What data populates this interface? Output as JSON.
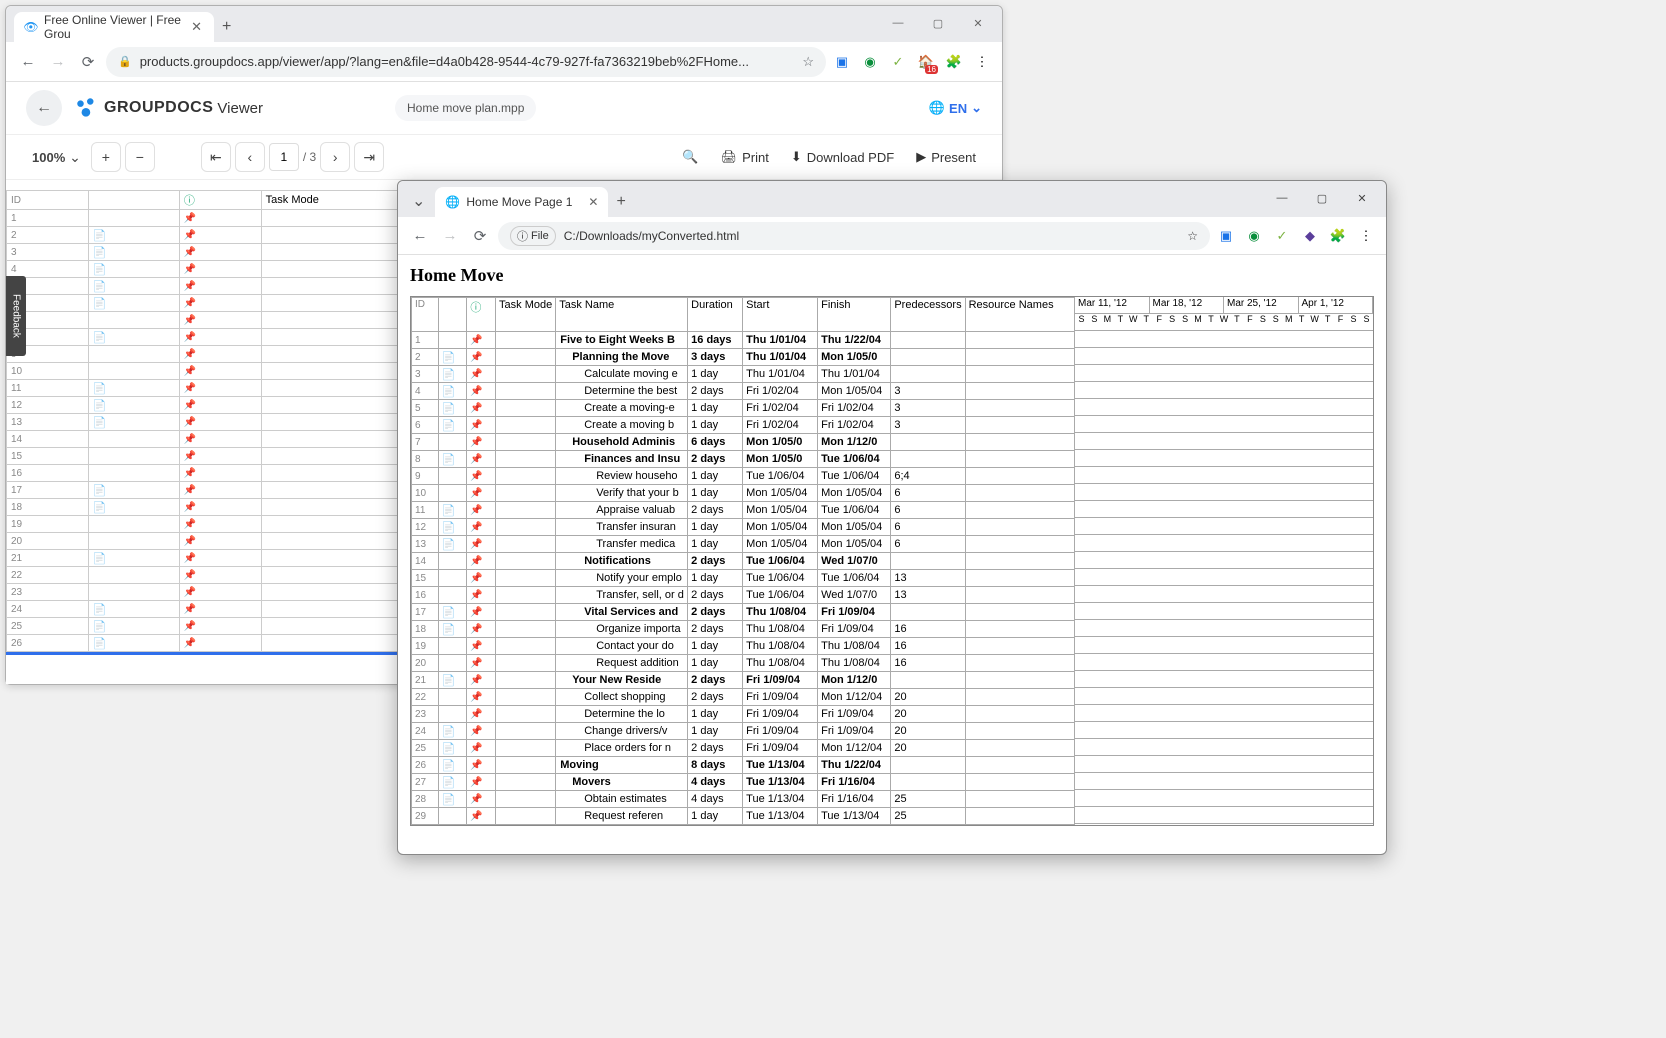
{
  "back": {
    "tab_title": "Free Online Viewer | Free Grou",
    "url": "products.groupdocs.app/viewer/app/?lang=en&file=d4a0b428-9544-4c79-927f-fa7363219beb%2FHome...",
    "ext_badge": "16",
    "gd_brand": "GROUPDOCS",
    "gd_brand2": "Viewer",
    "gd_file": "Home move plan.mpp",
    "lang": "EN",
    "zoom": "100%",
    "page_cur": "1",
    "page_tot": "/ 3",
    "act_print": "Print",
    "act_pdf": "Download PDF",
    "act_present": "Present",
    "feedback": "Feedback",
    "headers": [
      "ID",
      "",
      "",
      "Task Mode",
      "Task Name",
      "Duration",
      "Start"
    ],
    "rows": [
      {
        "id": "1",
        "note": "",
        "name": "Five to Eight Weeks Before",
        "dur": "16 days",
        "start": "Thu 1",
        "bold": true,
        "ind": 0
      },
      {
        "id": "2",
        "note": "y",
        "name": "Planning the Move",
        "dur": "3 days",
        "start": "Thu 1",
        "bold": true,
        "ind": 1
      },
      {
        "id": "3",
        "note": "y",
        "name": "Calculate moving exp",
        "dur": "1 day",
        "start": "Thu 1",
        "ind": 2
      },
      {
        "id": "4",
        "note": "y",
        "name": "Determine the best n",
        "dur": "2 days",
        "start": "Fri 1/",
        "ind": 2
      },
      {
        "id": "5",
        "note": "y",
        "name": "Create a moving-exp",
        "dur": "1 day",
        "start": "Fri 1/",
        "ind": 2
      },
      {
        "id": "6",
        "note": "y",
        "name": "Create a moving bin",
        "dur": "1 day",
        "start": "Fri 1/",
        "ind": 2
      },
      {
        "id": "7",
        "note": "",
        "name": "Household Administration",
        "dur": "6 days",
        "start": "Mon",
        "bold": true,
        "ind": 1
      },
      {
        "id": "8",
        "note": "y",
        "name": "Finances and Insurance",
        "dur": "2 days",
        "start": "Mon",
        "bold": true,
        "ind": 2
      },
      {
        "id": "9",
        "note": "",
        "name": "Review household fi",
        "dur": "1 day",
        "start": "Tue 1",
        "ind": 3
      },
      {
        "id": "10",
        "note": "",
        "name": "Verify that your bel",
        "dur": "1 day",
        "start": "Mon",
        "ind": 3
      },
      {
        "id": "11",
        "note": "y",
        "name": "Appraise valuables",
        "dur": "2 days",
        "start": "Mon",
        "ind": 3
      },
      {
        "id": "12",
        "note": "y",
        "name": "Transfer insurance",
        "dur": "1 day",
        "start": "Mon",
        "ind": 3
      },
      {
        "id": "13",
        "note": "y",
        "name": "Transfer medical in",
        "dur": "1 day",
        "start": "Mon",
        "ind": 3
      },
      {
        "id": "14",
        "note": "",
        "name": "Notifications",
        "dur": "2 days",
        "start": "Tue 1",
        "bold": true,
        "ind": 2
      },
      {
        "id": "15",
        "note": "",
        "name": "Notify your employ",
        "dur": "1 day",
        "start": "Tue 1",
        "ind": 3
      },
      {
        "id": "16",
        "note": "",
        "name": "Transfer, sell, or di",
        "dur": "2 days",
        "start": "Tue 1",
        "ind": 3
      },
      {
        "id": "17",
        "note": "y",
        "name": "Vital Services and R",
        "dur": "2 days",
        "start": "Thu 1",
        "bold": true,
        "ind": 2
      },
      {
        "id": "18",
        "note": "y",
        "name": "Organize important",
        "dur": "2 days",
        "start": "Thu 1",
        "ind": 3
      },
      {
        "id": "19",
        "note": "",
        "name": "Contact your docto",
        "dur": "1 day",
        "start": "Thu 1",
        "ind": 3
      },
      {
        "id": "20",
        "note": "",
        "name": "Request additional",
        "dur": "1 day",
        "start": "Thu 1",
        "ind": 3
      },
      {
        "id": "21",
        "note": "y",
        "name": "Your New Residence",
        "dur": "2 days",
        "start": "Fri 1/",
        "bold": true,
        "ind": 1
      },
      {
        "id": "22",
        "note": "",
        "name": "Collect shopping a",
        "dur": "2 days",
        "start": "Fri 1/",
        "ind": 2
      },
      {
        "id": "23",
        "note": "",
        "name": "Determine the loca",
        "dur": "1 day",
        "start": "Fri 1/",
        "ind": 2
      },
      {
        "id": "24",
        "note": "y",
        "name": "Change drivers/veh",
        "dur": "1 day",
        "start": "Fri 1/",
        "ind": 2
      },
      {
        "id": "25",
        "note": "y",
        "name": "Place orders for ne",
        "dur": "2 days",
        "start": "Fri 1/",
        "ind": 2
      },
      {
        "id": "26",
        "note": "y",
        "name": "Moving",
        "dur": "8 days",
        "start": "Tue 1",
        "bold": true,
        "ind": 0
      }
    ]
  },
  "front": {
    "tab_title": "Home Move Page 1",
    "file_proto": "File",
    "url": "C:/Downloads/myConverted.html",
    "h1": "Home Move",
    "headers": [
      "ID",
      "",
      "",
      "Task Mode",
      "Task Name",
      "Duration",
      "Start",
      "Finish",
      "Predecessors",
      "Resource Names"
    ],
    "dates": [
      "Mar 11, '12",
      "Mar 18, '12",
      "Mar 25, '12",
      "Apr 1, '12"
    ],
    "days": "SSMTWTFSSMTWTFSSMTWTFSS",
    "rows": [
      {
        "id": "1",
        "note": "",
        "name": "Five to Eight Weeks B",
        "dur": "16 days",
        "start": "Thu 1/01/04",
        "fin": "Thu 1/22/04",
        "pred": "",
        "bold": true,
        "ind": 0
      },
      {
        "id": "2",
        "note": "y",
        "name": "Planning the Move",
        "dur": "3 days",
        "start": "Thu 1/01/04",
        "fin": "Mon 1/05/0",
        "pred": "",
        "bold": true,
        "ind": 1
      },
      {
        "id": "3",
        "note": "y",
        "name": "Calculate moving e",
        "dur": "1 day",
        "start": "Thu 1/01/04",
        "fin": "Thu 1/01/04",
        "pred": "",
        "ind": 2
      },
      {
        "id": "4",
        "note": "y",
        "name": "Determine the best",
        "dur": "2 days",
        "start": "Fri 1/02/04",
        "fin": "Mon 1/05/04",
        "pred": "3",
        "ind": 2
      },
      {
        "id": "5",
        "note": "y",
        "name": "Create a moving-e",
        "dur": "1 day",
        "start": "Fri 1/02/04",
        "fin": "Fri 1/02/04",
        "pred": "3",
        "ind": 2
      },
      {
        "id": "6",
        "note": "y",
        "name": "Create a moving b",
        "dur": "1 day",
        "start": "Fri 1/02/04",
        "fin": "Fri 1/02/04",
        "pred": "3",
        "ind": 2
      },
      {
        "id": "7",
        "note": "",
        "name": "Household Adminis",
        "dur": "6 days",
        "start": "Mon 1/05/0",
        "fin": "Mon 1/12/0",
        "pred": "",
        "bold": true,
        "ind": 1
      },
      {
        "id": "8",
        "note": "y",
        "name": "Finances and Insu",
        "dur": "2 days",
        "start": "Mon 1/05/0",
        "fin": "Tue 1/06/04",
        "pred": "",
        "bold": true,
        "ind": 2
      },
      {
        "id": "9",
        "note": "",
        "name": "Review househo",
        "dur": "1 day",
        "start": "Tue 1/06/04",
        "fin": "Tue 1/06/04",
        "pred": "6;4",
        "ind": 3
      },
      {
        "id": "10",
        "note": "",
        "name": "Verify that your b",
        "dur": "1 day",
        "start": "Mon 1/05/04",
        "fin": "Mon 1/05/04",
        "pred": "6",
        "ind": 3
      },
      {
        "id": "11",
        "note": "y",
        "name": "Appraise valuab",
        "dur": "2 days",
        "start": "Mon 1/05/04",
        "fin": "Tue 1/06/04",
        "pred": "6",
        "ind": 3
      },
      {
        "id": "12",
        "note": "y",
        "name": "Transfer insuran",
        "dur": "1 day",
        "start": "Mon 1/05/04",
        "fin": "Mon 1/05/04",
        "pred": "6",
        "ind": 3
      },
      {
        "id": "13",
        "note": "y",
        "name": "Transfer medica",
        "dur": "1 day",
        "start": "Mon 1/05/04",
        "fin": "Mon 1/05/04",
        "pred": "6",
        "ind": 3
      },
      {
        "id": "14",
        "note": "",
        "name": "Notifications",
        "dur": "2 days",
        "start": "Tue 1/06/04",
        "fin": "Wed 1/07/0",
        "pred": "",
        "bold": true,
        "ind": 2
      },
      {
        "id": "15",
        "note": "",
        "name": "Notify your emplo",
        "dur": "1 day",
        "start": "Tue 1/06/04",
        "fin": "Tue 1/06/04",
        "pred": "13",
        "ind": 3
      },
      {
        "id": "16",
        "note": "",
        "name": "Transfer, sell, or d",
        "dur": "2 days",
        "start": "Tue 1/06/04",
        "fin": "Wed 1/07/0",
        "pred": "13",
        "ind": 3
      },
      {
        "id": "17",
        "note": "y",
        "name": "Vital Services and",
        "dur": "2 days",
        "start": "Thu 1/08/04",
        "fin": "Fri 1/09/04",
        "pred": "",
        "bold": true,
        "ind": 2
      },
      {
        "id": "18",
        "note": "y",
        "name": "Organize importa",
        "dur": "2 days",
        "start": "Thu 1/08/04",
        "fin": "Fri 1/09/04",
        "pred": "16",
        "ind": 3
      },
      {
        "id": "19",
        "note": "",
        "name": "Contact your do",
        "dur": "1 day",
        "start": "Thu 1/08/04",
        "fin": "Thu 1/08/04",
        "pred": "16",
        "ind": 3
      },
      {
        "id": "20",
        "note": "",
        "name": "Request addition",
        "dur": "1 day",
        "start": "Thu 1/08/04",
        "fin": "Thu 1/08/04",
        "pred": "16",
        "ind": 3
      },
      {
        "id": "21",
        "note": "y",
        "name": "Your New Reside",
        "dur": "2 days",
        "start": "Fri 1/09/04",
        "fin": "Mon 1/12/0",
        "pred": "",
        "bold": true,
        "ind": 1
      },
      {
        "id": "22",
        "note": "",
        "name": "Collect shopping",
        "dur": "2 days",
        "start": "Fri 1/09/04",
        "fin": "Mon 1/12/04",
        "pred": "20",
        "ind": 2
      },
      {
        "id": "23",
        "note": "",
        "name": "Determine the lo",
        "dur": "1 day",
        "start": "Fri 1/09/04",
        "fin": "Fri 1/09/04",
        "pred": "20",
        "ind": 2
      },
      {
        "id": "24",
        "note": "y",
        "name": "Change drivers/v",
        "dur": "1 day",
        "start": "Fri 1/09/04",
        "fin": "Fri 1/09/04",
        "pred": "20",
        "ind": 2
      },
      {
        "id": "25",
        "note": "y",
        "name": "Place orders for n",
        "dur": "2 days",
        "start": "Fri 1/09/04",
        "fin": "Mon 1/12/04",
        "pred": "20",
        "ind": 2
      },
      {
        "id": "26",
        "note": "y",
        "name": "Moving",
        "dur": "8 days",
        "start": "Tue 1/13/04",
        "fin": "Thu 1/22/04",
        "pred": "",
        "bold": true,
        "ind": 0
      },
      {
        "id": "27",
        "note": "y",
        "name": "Movers",
        "dur": "4 days",
        "start": "Tue 1/13/04",
        "fin": "Fri 1/16/04",
        "pred": "",
        "bold": true,
        "ind": 1
      },
      {
        "id": "28",
        "note": "y",
        "name": "Obtain estimates",
        "dur": "4 days",
        "start": "Tue 1/13/04",
        "fin": "Fri 1/16/04",
        "pred": "25",
        "ind": 2
      },
      {
        "id": "29",
        "note": "",
        "name": "Request referen",
        "dur": "1 day",
        "start": "Tue 1/13/04",
        "fin": "Tue 1/13/04",
        "pred": "25",
        "ind": 2
      }
    ]
  }
}
